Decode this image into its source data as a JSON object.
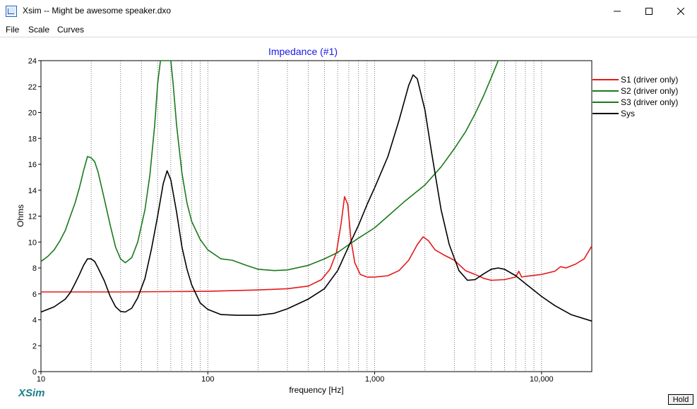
{
  "window": {
    "title": "Xsim -- Might be awesome speaker.dxo"
  },
  "menu": {
    "items": [
      "File",
      "Scale",
      "Curves"
    ]
  },
  "branding": {
    "logo_text": "XSim"
  },
  "buttons": {
    "hold_label": "Hold"
  },
  "icons": [
    "app-icon",
    "minimize-icon",
    "maximize-icon",
    "close-icon"
  ],
  "chart_data": {
    "type": "line",
    "title": "Impedance (#1)",
    "xlabel": "frequency [Hz]",
    "ylabel": "Ohms",
    "xscale": "log",
    "xlim": [
      10,
      20000
    ],
    "ylim": [
      0,
      24
    ],
    "y_ticks": [
      0,
      2,
      4,
      6,
      8,
      10,
      12,
      14,
      16,
      18,
      20,
      22,
      24
    ],
    "x_tick_labels": [
      {
        "value": 10,
        "label": "10"
      },
      {
        "value": 100,
        "label": "100"
      },
      {
        "value": 1000,
        "label": "1,000"
      },
      {
        "value": 10000,
        "label": "10,000"
      }
    ],
    "grid": true,
    "legend_position": "right",
    "series": [
      {
        "name": "S1 (driver only)",
        "color": "#e31a1a",
        "points": [
          [
            10,
            6.15
          ],
          [
            30,
            6.15
          ],
          [
            100,
            6.2
          ],
          [
            200,
            6.3
          ],
          [
            300,
            6.4
          ],
          [
            400,
            6.6
          ],
          [
            480,
            7.1
          ],
          [
            540,
            7.9
          ],
          [
            590,
            9.2
          ],
          [
            630,
            11.5
          ],
          [
            660,
            13.5
          ],
          [
            690,
            12.9
          ],
          [
            720,
            10.2
          ],
          [
            760,
            8.4
          ],
          [
            820,
            7.5
          ],
          [
            900,
            7.3
          ],
          [
            1000,
            7.3
          ],
          [
            1200,
            7.4
          ],
          [
            1400,
            7.8
          ],
          [
            1600,
            8.6
          ],
          [
            1800,
            9.8
          ],
          [
            1950,
            10.4
          ],
          [
            2100,
            10.1
          ],
          [
            2300,
            9.4
          ],
          [
            2600,
            9.0
          ],
          [
            3000,
            8.6
          ],
          [
            3500,
            7.8
          ],
          [
            4000,
            7.5
          ],
          [
            4500,
            7.2
          ],
          [
            5000,
            7.05
          ],
          [
            6000,
            7.1
          ],
          [
            7000,
            7.3
          ],
          [
            7300,
            7.75
          ],
          [
            7600,
            7.3
          ],
          [
            8000,
            7.35
          ],
          [
            10000,
            7.5
          ],
          [
            12000,
            7.75
          ],
          [
            13000,
            8.1
          ],
          [
            14000,
            8.0
          ],
          [
            16000,
            8.3
          ],
          [
            18000,
            8.7
          ],
          [
            20000,
            9.7
          ]
        ]
      },
      {
        "name": "S2 (driver only)",
        "color": "#1a7a1a",
        "points": [
          [
            10,
            8.5
          ],
          [
            11,
            8.9
          ],
          [
            12,
            9.4
          ],
          [
            13,
            10.1
          ],
          [
            14,
            10.9
          ],
          [
            15,
            12.0
          ],
          [
            16,
            13.0
          ],
          [
            17,
            14.2
          ],
          [
            18,
            15.5
          ],
          [
            19,
            16.6
          ],
          [
            20,
            16.5
          ],
          [
            21,
            16.2
          ],
          [
            22,
            15.4
          ],
          [
            24,
            13.3
          ],
          [
            26,
            11.3
          ],
          [
            28,
            9.6
          ],
          [
            30,
            8.7
          ],
          [
            32,
            8.4
          ],
          [
            35,
            8.8
          ],
          [
            38,
            10.0
          ],
          [
            42,
            12.5
          ],
          [
            45,
            15.2
          ],
          [
            48,
            19.0
          ],
          [
            50,
            22.2
          ],
          [
            52,
            24.0
          ],
          [
            60,
            24.0
          ],
          [
            62,
            22.2
          ],
          [
            65,
            19.0
          ],
          [
            70,
            15.3
          ],
          [
            75,
            13.0
          ],
          [
            80,
            11.6
          ],
          [
            90,
            10.2
          ],
          [
            100,
            9.4
          ],
          [
            120,
            8.7
          ],
          [
            140,
            8.6
          ],
          [
            170,
            8.2
          ],
          [
            200,
            7.9
          ],
          [
            250,
            7.8
          ],
          [
            300,
            7.85
          ],
          [
            400,
            8.2
          ],
          [
            500,
            8.7
          ],
          [
            600,
            9.2
          ],
          [
            700,
            9.8
          ],
          [
            800,
            10.3
          ],
          [
            1000,
            11.1
          ],
          [
            1200,
            12.0
          ],
          [
            1500,
            13.1
          ],
          [
            2000,
            14.4
          ],
          [
            2500,
            15.8
          ],
          [
            3000,
            17.2
          ],
          [
            3500,
            18.5
          ],
          [
            4000,
            19.9
          ],
          [
            4500,
            21.3
          ],
          [
            5000,
            22.7
          ],
          [
            5500,
            24.0
          ]
        ]
      },
      {
        "name": "S3 (driver only)",
        "color": "#1a7a1a",
        "points": []
      },
      {
        "name": "Sys",
        "color": "#000000",
        "points": [
          [
            10,
            4.6
          ],
          [
            12,
            5.0
          ],
          [
            14,
            5.6
          ],
          [
            15,
            6.1
          ],
          [
            16,
            6.8
          ],
          [
            17,
            7.5
          ],
          [
            18,
            8.2
          ],
          [
            19,
            8.7
          ],
          [
            20,
            8.7
          ],
          [
            21,
            8.5
          ],
          [
            22,
            8.0
          ],
          [
            24,
            7.0
          ],
          [
            26,
            5.8
          ],
          [
            28,
            5.0
          ],
          [
            30,
            4.65
          ],
          [
            32,
            4.6
          ],
          [
            35,
            4.9
          ],
          [
            38,
            5.7
          ],
          [
            42,
            7.2
          ],
          [
            46,
            9.5
          ],
          [
            50,
            12.0
          ],
          [
            54,
            14.5
          ],
          [
            57,
            15.5
          ],
          [
            60,
            14.8
          ],
          [
            65,
            12.3
          ],
          [
            70,
            9.6
          ],
          [
            75,
            7.9
          ],
          [
            80,
            6.7
          ],
          [
            90,
            5.3
          ],
          [
            100,
            4.8
          ],
          [
            120,
            4.4
          ],
          [
            150,
            4.35
          ],
          [
            200,
            4.35
          ],
          [
            250,
            4.5
          ],
          [
            300,
            4.85
          ],
          [
            400,
            5.6
          ],
          [
            500,
            6.4
          ],
          [
            600,
            7.8
          ],
          [
            700,
            9.7
          ],
          [
            800,
            11.3
          ],
          [
            900,
            12.9
          ],
          [
            1000,
            14.2
          ],
          [
            1200,
            16.6
          ],
          [
            1400,
            19.4
          ],
          [
            1600,
            22.1
          ],
          [
            1700,
            22.9
          ],
          [
            1800,
            22.6
          ],
          [
            2000,
            20.2
          ],
          [
            2200,
            16.8
          ],
          [
            2500,
            12.5
          ],
          [
            2800,
            9.8
          ],
          [
            3200,
            7.8
          ],
          [
            3600,
            7.05
          ],
          [
            4000,
            7.1
          ],
          [
            4500,
            7.55
          ],
          [
            5000,
            7.9
          ],
          [
            5500,
            8.0
          ],
          [
            6000,
            7.9
          ],
          [
            7000,
            7.4
          ],
          [
            8000,
            6.8
          ],
          [
            10000,
            5.8
          ],
          [
            12000,
            5.1
          ],
          [
            15000,
            4.4
          ],
          [
            20000,
            3.9
          ]
        ]
      }
    ]
  }
}
